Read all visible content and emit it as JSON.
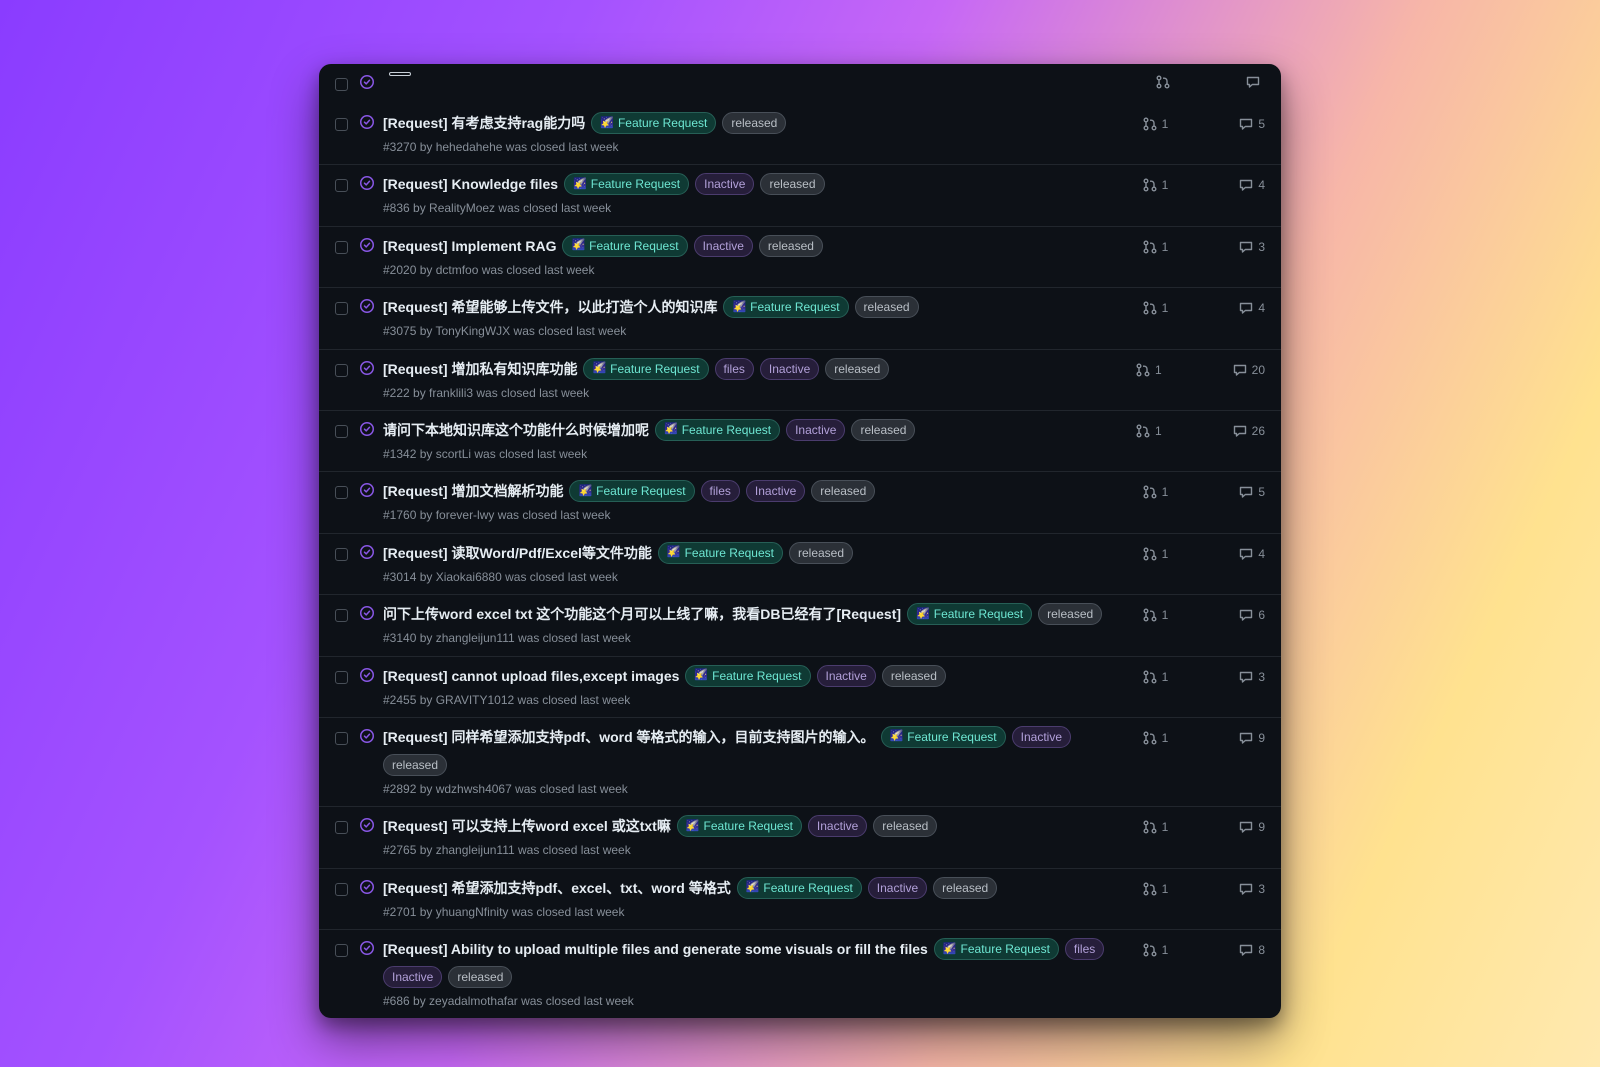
{
  "colors": {
    "closed_status": "#8957e5",
    "panel_bg": "#0d1117",
    "border": "#21262d"
  },
  "label_palette": {
    "feature_request": {
      "text": "#6ee7d3",
      "bg": "#0f3a34",
      "border": "#265f56",
      "star": "🌠"
    },
    "inactive": {
      "text": "#b2a0d9",
      "bg": "#261e3a",
      "border": "#4b3c6e"
    },
    "released": {
      "text": "#b9bfc6",
      "bg": "#2b3037",
      "border": "#484f58"
    },
    "files": {
      "text": "#b2a0d9",
      "bg": "#261e3a",
      "border": "#4b3c6e"
    }
  },
  "label_names": {
    "feature_request": "Feature Request",
    "inactive": "Inactive",
    "released": "released",
    "files": "files"
  },
  "issues": [
    {
      "title": "[Request] 有考虑支持rag能力吗",
      "meta": "#3270 by hehedahehe was closed last week",
      "labels": [
        "feature_request",
        "released"
      ],
      "pr_links": 1,
      "comments": 5
    },
    {
      "title": "[Request] Knowledge files",
      "meta": "#836 by RealityMoez was closed last week",
      "labels": [
        "feature_request",
        "inactive",
        "released"
      ],
      "pr_links": 1,
      "comments": 4
    },
    {
      "title": "[Request] Implement RAG",
      "meta": "#2020 by dctmfoo was closed last week",
      "labels": [
        "feature_request",
        "inactive",
        "released"
      ],
      "pr_links": 1,
      "comments": 3
    },
    {
      "title": "[Request] 希望能够上传文件，以此打造个人的知识库",
      "meta": "#3075 by TonyKingWJX was closed last week",
      "labels": [
        "feature_request",
        "released"
      ],
      "pr_links": 1,
      "comments": 4
    },
    {
      "title": "[Request] 增加私有知识库功能",
      "meta": "#222 by franklili3 was closed last week",
      "labels": [
        "feature_request",
        "files",
        "inactive",
        "released"
      ],
      "pr_links": 1,
      "comments": 20
    },
    {
      "title": "请问下本地知识库这个功能什么时候增加呢",
      "meta": "#1342 by scortLi was closed last week",
      "labels": [
        "feature_request",
        "inactive",
        "released"
      ],
      "pr_links": 1,
      "comments": 26
    },
    {
      "title": "[Request] 增加文档解析功能",
      "meta": "#1760 by forever-lwy was closed last week",
      "labels": [
        "feature_request",
        "files",
        "inactive",
        "released"
      ],
      "pr_links": 1,
      "comments": 5
    },
    {
      "title": "[Request] 读取Word/Pdf/Excel等文件功能",
      "meta": "#3014 by Xiaokai6880 was closed last week",
      "labels": [
        "feature_request",
        "released"
      ],
      "pr_links": 1,
      "comments": 4
    },
    {
      "title": "问下上传word excel txt 这个功能这个月可以上线了嘛，我看DB已经有了[Request]",
      "meta": "#3140 by zhangleijun111 was closed last week",
      "labels": [
        "feature_request",
        "released"
      ],
      "pr_links": 1,
      "comments": 6
    },
    {
      "title": "[Request] cannot upload files,except images",
      "meta": "#2455 by GRAVITY1012 was closed last week",
      "labels": [
        "feature_request",
        "inactive",
        "released"
      ],
      "pr_links": 1,
      "comments": 3
    },
    {
      "title": "[Request] 同样希望添加支持pdf、word 等格式的输入，目前支持图片的输入。",
      "meta": "#2892 by wdzhwsh4067 was closed last week",
      "labels": [
        "feature_request",
        "inactive",
        "released"
      ],
      "pr_links": 1,
      "comments": 9
    },
    {
      "title": "[Request] 可以支持上传word excel 或这txt嘛",
      "meta": "#2765 by zhangleijun111 was closed last week",
      "labels": [
        "feature_request",
        "inactive",
        "released"
      ],
      "pr_links": 1,
      "comments": 9
    },
    {
      "title": "[Request] 希望添加支持pdf、excel、txt、word 等格式",
      "meta": "#2701 by yhuangNfinity was closed last week",
      "labels": [
        "feature_request",
        "inactive",
        "released"
      ],
      "pr_links": 1,
      "comments": 3
    },
    {
      "title": "[Request] Ability to upload multiple files and generate some visuals or fill the files",
      "meta": "#686 by zeyadalmothafar was closed last week",
      "labels": [
        "feature_request",
        "files",
        "inactive",
        "released"
      ],
      "pr_links": 1,
      "comments": 8
    }
  ]
}
